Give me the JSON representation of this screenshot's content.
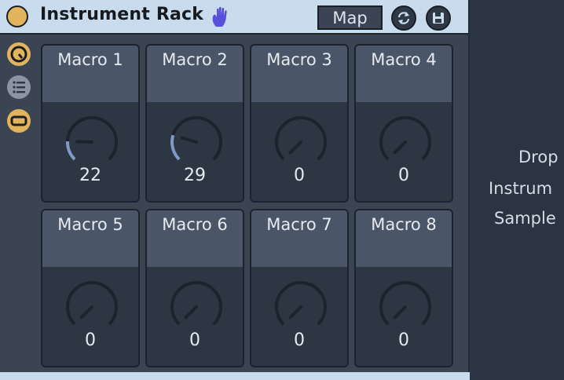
{
  "device": {
    "title": "Instrument Rack",
    "map_label": "Map",
    "icons": {
      "power": "power-icon",
      "hand": "hand-icon",
      "randomize": "randomize-icon",
      "save": "save-preset-icon"
    },
    "colors": {
      "accent": "#e3b45e",
      "titlebar": "#c9dced",
      "body": "#3a4453",
      "knob_arc": "#7f9ac6",
      "hand": "#5a4fd8"
    }
  },
  "sidebar": {
    "buttons": [
      {
        "icon": "macro-view-icon",
        "active": true
      },
      {
        "icon": "chain-list-icon",
        "active": false
      },
      {
        "icon": "device-view-icon",
        "active": true
      }
    ]
  },
  "macros": [
    {
      "label": "Macro 1",
      "value": "22",
      "level": 0.173
    },
    {
      "label": "Macro 2",
      "value": "29",
      "level": 0.228
    },
    {
      "label": "Macro 3",
      "value": "0",
      "level": 0
    },
    {
      "label": "Macro 4",
      "value": "0",
      "level": 0
    },
    {
      "label": "Macro 5",
      "value": "0",
      "level": 0
    },
    {
      "label": "Macro 6",
      "value": "0",
      "level": 0
    },
    {
      "label": "Macro 7",
      "value": "0",
      "level": 0
    },
    {
      "label": "Macro 8",
      "value": "0",
      "level": 0
    }
  ],
  "drop_area": {
    "lines": [
      "Drop",
      "Instrum",
      "Sample"
    ]
  }
}
